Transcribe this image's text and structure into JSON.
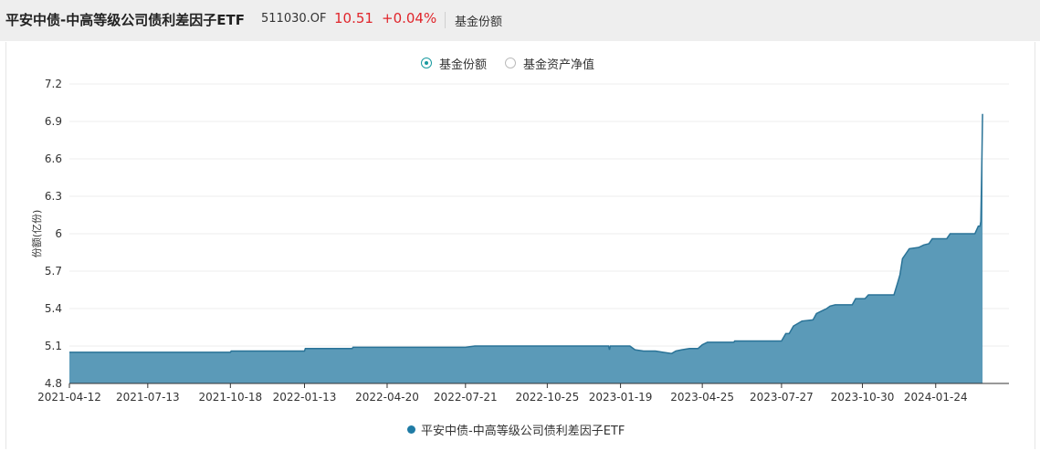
{
  "header": {
    "fund_name": "平安中债-中高等级公司债利差因子ETF",
    "fund_code": "511030.OF",
    "nav": "10.51",
    "change": "+0.04%",
    "tab": "基金份额"
  },
  "toggle": {
    "option1": "基金份额",
    "option2": "基金资产净值",
    "selected": "基金份额"
  },
  "colors": {
    "area_fill": "#5b9ab8",
    "area_line": "#2a7397",
    "accent": "#1a9aa0",
    "up": "#e0252b"
  },
  "chart_data": {
    "type": "area",
    "ylabel": "份额(亿份)",
    "ylim": [
      4.8,
      7.2
    ],
    "yticks": [
      "7.2",
      "6.9",
      "6.6",
      "6.3",
      "6",
      "5.7",
      "5.4",
      "5.1",
      "4.8"
    ],
    "xlim": [
      "2021-04-12",
      "2024-04-19"
    ],
    "xticks": [
      "2021-04-12",
      "2021-07-13",
      "2021-10-18",
      "2022-01-13",
      "2022-04-20",
      "2022-07-21",
      "2022-10-25",
      "2023-01-19",
      "2023-04-25",
      "2023-07-27",
      "2023-10-30",
      "2024-01-24"
    ],
    "grid": true,
    "series": [
      {
        "name": "平安中债-中高等级公司债利差因子ETF",
        "points": [
          [
            "2021-04-12",
            5.05
          ],
          [
            "2021-10-18",
            5.05
          ],
          [
            "2021-10-19",
            5.06
          ],
          [
            "2022-01-13",
            5.06
          ],
          [
            "2022-01-14",
            5.08
          ],
          [
            "2022-03-10",
            5.08
          ],
          [
            "2022-03-11",
            5.09
          ],
          [
            "2022-07-21",
            5.09
          ],
          [
            "2022-08-01",
            5.1
          ],
          [
            "2023-01-05",
            5.1
          ],
          [
            "2023-01-06",
            5.07
          ],
          [
            "2023-01-07",
            5.1
          ],
          [
            "2023-01-30",
            5.1
          ],
          [
            "2023-02-05",
            5.07
          ],
          [
            "2023-02-15",
            5.06
          ],
          [
            "2023-03-01",
            5.06
          ],
          [
            "2023-03-10",
            5.05
          ],
          [
            "2023-03-20",
            5.04
          ],
          [
            "2023-03-25",
            5.06
          ],
          [
            "2023-04-01",
            5.07
          ],
          [
            "2023-04-10",
            5.08
          ],
          [
            "2023-04-20",
            5.08
          ],
          [
            "2023-04-25",
            5.11
          ],
          [
            "2023-05-01",
            5.13
          ],
          [
            "2023-06-01",
            5.13
          ],
          [
            "2023-06-02",
            5.14
          ],
          [
            "2023-07-27",
            5.14
          ],
          [
            "2023-08-01",
            5.2
          ],
          [
            "2023-08-05",
            5.2
          ],
          [
            "2023-08-10",
            5.26
          ],
          [
            "2023-08-20",
            5.3
          ],
          [
            "2023-09-02",
            5.31
          ],
          [
            "2023-09-06",
            5.36
          ],
          [
            "2023-09-12",
            5.38
          ],
          [
            "2023-09-18",
            5.4
          ],
          [
            "2023-09-22",
            5.42
          ],
          [
            "2023-09-28",
            5.43
          ],
          [
            "2023-10-18",
            5.43
          ],
          [
            "2023-10-22",
            5.48
          ],
          [
            "2023-11-02",
            5.48
          ],
          [
            "2023-11-06",
            5.51
          ],
          [
            "2023-12-06",
            5.51
          ],
          [
            "2023-12-10",
            5.6
          ],
          [
            "2023-12-13",
            5.67
          ],
          [
            "2023-12-16",
            5.8
          ],
          [
            "2023-12-20",
            5.84
          ],
          [
            "2023-12-24",
            5.88
          ],
          [
            "2024-01-04",
            5.89
          ],
          [
            "2024-01-10",
            5.91
          ],
          [
            "2024-01-16",
            5.92
          ],
          [
            "2024-01-20",
            5.96
          ],
          [
            "2024-02-06",
            5.96
          ],
          [
            "2024-02-10",
            6.0
          ],
          [
            "2024-03-10",
            6.0
          ],
          [
            "2024-03-14",
            6.06
          ],
          [
            "2024-03-16",
            6.06
          ],
          [
            "2024-03-17",
            6.1
          ],
          [
            "2024-03-18",
            6.5
          ],
          [
            "2024-03-19",
            6.96
          ]
        ]
      }
    ]
  }
}
